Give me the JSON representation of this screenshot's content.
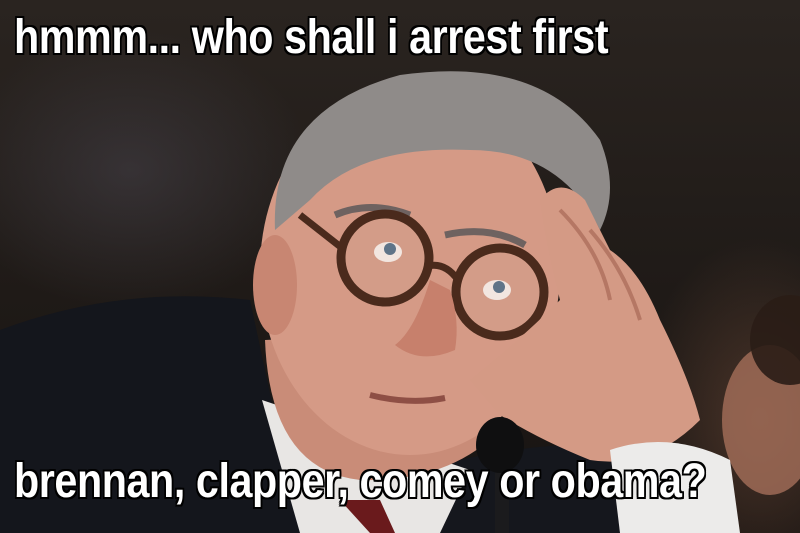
{
  "meme": {
    "top_text": "hmmm... who shall i arrest first",
    "bottom_text": "brennan, clapper, comey or obama?"
  },
  "colors": {
    "caption_fill": "#ffffff",
    "caption_outline": "#000000",
    "background": "#1f1a17",
    "suit": "#14161c",
    "skin": "#d79c8a",
    "hair": "#8b8785",
    "glasses_frame": "#4a2a1c"
  },
  "icons": [
    "microphone-icon"
  ]
}
